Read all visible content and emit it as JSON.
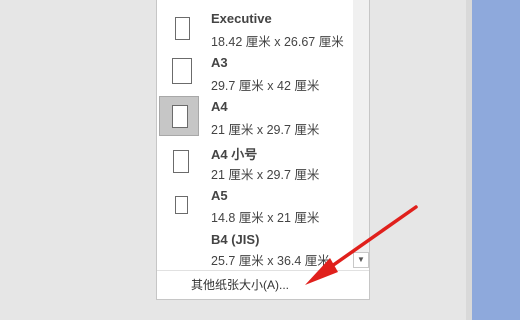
{
  "paper_sizes": [
    {
      "name": "Executive",
      "dims": "18.42 厘米 x 26.67 厘米",
      "selected": false
    },
    {
      "name": "A3",
      "dims": "29.7 厘米 x 42 厘米",
      "selected": false
    },
    {
      "name": "A4",
      "dims": "21 厘米 x 29.7 厘米",
      "selected": true
    },
    {
      "name": "A4 小号",
      "dims": "21 厘米 x 29.7 厘米",
      "selected": false
    },
    {
      "name": "A5",
      "dims": "14.8 厘米 x 21 厘米",
      "selected": false
    },
    {
      "name": "B4 (JIS)",
      "dims": "25.7 厘米 x 36.4 厘米",
      "selected": false
    }
  ],
  "more_sizes_label": "其他纸张大小(A)...",
  "scroll_down_glyph": "▼",
  "colors": {
    "selected_bg": "#c6c6c6",
    "annotation_arrow": "#e0201c",
    "side_panel": "#8ea9dc"
  }
}
